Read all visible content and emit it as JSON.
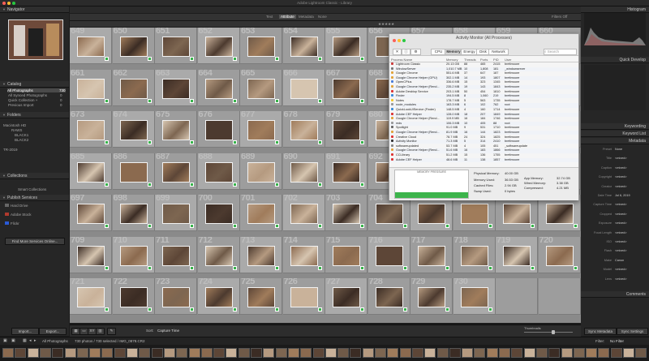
{
  "window": {
    "title": "Adobe Lightroom Classic - Library"
  },
  "left_panel": {
    "navigator": "Navigator",
    "catalog": "Catalog",
    "catalog_items": [
      {
        "label": "All Photographs",
        "count": "730"
      },
      {
        "label": "All Synced Photographs",
        "count": "0"
      },
      {
        "label": "Quick Collection +",
        "count": "0"
      },
      {
        "label": "Previous Import",
        "count": "0"
      }
    ],
    "folders": "Folders",
    "folder_items": [
      "Macintosh HD",
      "RAWS",
      "BLACK1",
      "BLACK2",
      "TR-2019"
    ],
    "collections": "Collections",
    "collection_items": [
      "Smart Collections"
    ],
    "publish": "Publish Services",
    "publish_items": [
      "Hard Drive",
      "Adobe Stock",
      "Flickr",
      "Find More Services Online..."
    ],
    "import_label": "Import...",
    "export_label": "Export..."
  },
  "top": {
    "tabs": [
      "Text",
      "Attribute",
      "Metadata",
      "None"
    ],
    "active_tab": "Attribute",
    "filters_label": "Filters Off"
  },
  "grid": {
    "rows": [
      [
        "649",
        "650",
        "651",
        "652",
        "653",
        "654",
        "655",
        "656",
        "657",
        "658",
        "659",
        "660"
      ],
      [
        "661",
        "662",
        "663",
        "664",
        "665",
        "666",
        "667",
        "668",
        "669",
        "670",
        "671",
        "672"
      ],
      [
        "673",
        "674",
        "675",
        "676",
        "677",
        "678",
        "679",
        "680",
        "681",
        "682",
        "683",
        "684"
      ],
      [
        "685",
        "686",
        "687",
        "688",
        "689",
        "690",
        "691",
        "692",
        "693",
        "694",
        "695",
        "696"
      ],
      [
        "697",
        "698",
        "699",
        "700",
        "701",
        "702",
        "703",
        "704",
        "705",
        "706",
        "707",
        "708"
      ],
      [
        "709",
        "710",
        "711",
        "712",
        "713",
        "714",
        "715",
        "716",
        "717",
        "718",
        "719",
        "720"
      ],
      [
        "721",
        "722",
        "723",
        "724",
        "725",
        "726",
        "727",
        "728",
        "729",
        "730",
        "",
        ""
      ]
    ]
  },
  "bottom": {
    "sort_label": "Sort:",
    "sort_value": "Capture Time",
    "thumbnails_label": "Thumbnails",
    "sync_metadata": "Sync Metadata",
    "sync_settings": "Sync Settings"
  },
  "status": {
    "source": "All Photographs",
    "summary": "730 photos / 730 selected / IMG_0878.CR2",
    "filter_label": "Filter:",
    "filter_value": "No Filter"
  },
  "right_panel": {
    "histogram": "Histogram",
    "quick_develop": "Quick Develop",
    "keywording": "Keywording",
    "keyword_list": "Keyword List",
    "metadata": "Metadata",
    "comments": "Comments",
    "meta_fields": [
      {
        "k": "Preset",
        "v": "None"
      },
      {
        "k": "Title",
        "v": "<mixed>"
      },
      {
        "k": "Caption",
        "v": "<mixed>"
      },
      {
        "k": "Copyright",
        "v": "<mixed>"
      },
      {
        "k": "Creator",
        "v": "<mixed>"
      },
      {
        "k": "Date Time",
        "v": "Jul 6, 2019"
      },
      {
        "k": "Capture Time",
        "v": "<mixed>"
      },
      {
        "k": "Cropped",
        "v": "<mixed>"
      },
      {
        "k": "Exposure",
        "v": "<mixed>"
      },
      {
        "k": "Focal Length",
        "v": "<mixed>"
      },
      {
        "k": "ISO",
        "v": "<mixed>"
      },
      {
        "k": "Flash",
        "v": "<mixed>"
      },
      {
        "k": "Make",
        "v": "Canon"
      },
      {
        "k": "Model",
        "v": "<mixed>"
      },
      {
        "k": "Lens",
        "v": "<mixed>"
      }
    ]
  },
  "activity_monitor": {
    "title": "Activity Monitor (All Processes)",
    "tabs": [
      "CPU",
      "Memory",
      "Energy",
      "Disk",
      "Network"
    ],
    "active_tab": "Memory",
    "search_placeholder": "Search",
    "columns": [
      "Process Name",
      "Memory",
      "Threads",
      "Ports",
      "PID",
      "User"
    ],
    "processes": [
      [
        "Lightroom Classic",
        "20.13 GB",
        "88",
        "465",
        "2415",
        "brettmoore"
      ],
      [
        "WindowServer",
        "1,010.7 MB",
        "10",
        "1,808",
        "181",
        "_windowserver"
      ],
      [
        "Google Chrome",
        "551.6 MB",
        "37",
        "647",
        "187",
        "brettmoore"
      ],
      [
        "Google Chrome Helper (GPU)",
        "302.1 MB",
        "14",
        "193",
        "1807",
        "brettmoore"
      ],
      [
        "OpenCPlus",
        "336.6 MB",
        "15",
        "323",
        "1345",
        "brettmoore"
      ],
      [
        "Google Chrome Helper (Rend...",
        "235.2 MB",
        "19",
        "143",
        "1843",
        "brettmoore"
      ],
      [
        "Adobe Desktop Service",
        "203.1 MB",
        "50",
        "454",
        "1810",
        "brettmoore"
      ],
      [
        "Finder",
        "194.5 MB",
        "8",
        "1,060",
        "219",
        "brettmoore"
      ],
      [
        "Notes",
        "178.7 MB",
        "5",
        "563",
        "1735",
        "brettmoore"
      ],
      [
        "node_modules",
        "163.3 MB",
        "6",
        "102",
        "762",
        "root"
      ],
      [
        "QuickLookUIService (Finder)",
        "148.5 MB",
        "4",
        "160",
        "1714",
        "brettmoore"
      ],
      [
        "Adobe CEF Helper",
        "128.0 MB",
        "18",
        "207",
        "1849",
        "brettmoore"
      ],
      [
        "Google Chrome Helper (Rend...",
        "119.9 MB",
        "16",
        "184",
        "1746",
        "brettmoore"
      ],
      [
        "mds",
        "106.3 MB",
        "10",
        "405",
        "88",
        "root"
      ],
      [
        "Spotlight",
        "91.0 MB",
        "9",
        "531",
        "1710",
        "brettmoore"
      ],
      [
        "Google Chrome Helper (Rend...",
        "81.9 MB",
        "16",
        "144",
        "1823",
        "brettmoore"
      ],
      [
        "Creative Cloud",
        "78.7 MB",
        "24",
        "324",
        "1825",
        "brettmoore"
      ],
      [
        "Activity Monitor",
        "71.3 MB",
        "5",
        "314",
        "2410",
        "brettmoore"
      ],
      [
        "softwareupdated",
        "53.7 MB",
        "4",
        "105",
        "451",
        "_softwareupdate"
      ],
      [
        "Google Chrome Helper (Rend...",
        "51.6 MB",
        "16",
        "183",
        "1866",
        "brettmoore"
      ],
      [
        "CCLibrary",
        "51.2 MB",
        "15",
        "136",
        "1755",
        "brettmoore"
      ],
      [
        "Adobe CEF Helper",
        "48.6 MB",
        "11",
        "138",
        "1857",
        "brettmoore"
      ]
    ],
    "pressure_label": "MEMORY PRESSURE",
    "physical_memory": {
      "label": "Physical Memory:",
      "value": "40.00 GB"
    },
    "memory_used": {
      "label": "Memory Used:",
      "value": "36.53 GB"
    },
    "cached_files": {
      "label": "Cached Files:",
      "value": "2.94 GB"
    },
    "swap_used": {
      "label": "Swap Used:",
      "value": "0 bytes"
    },
    "app_memory": {
      "label": "App Memory:",
      "value": "32.74 GB"
    },
    "wired_memory": {
      "label": "Wired Memory:",
      "value": "3.38 GB"
    },
    "compressed": {
      "label": "Compressed:",
      "value": "4.21 MB"
    }
  }
}
